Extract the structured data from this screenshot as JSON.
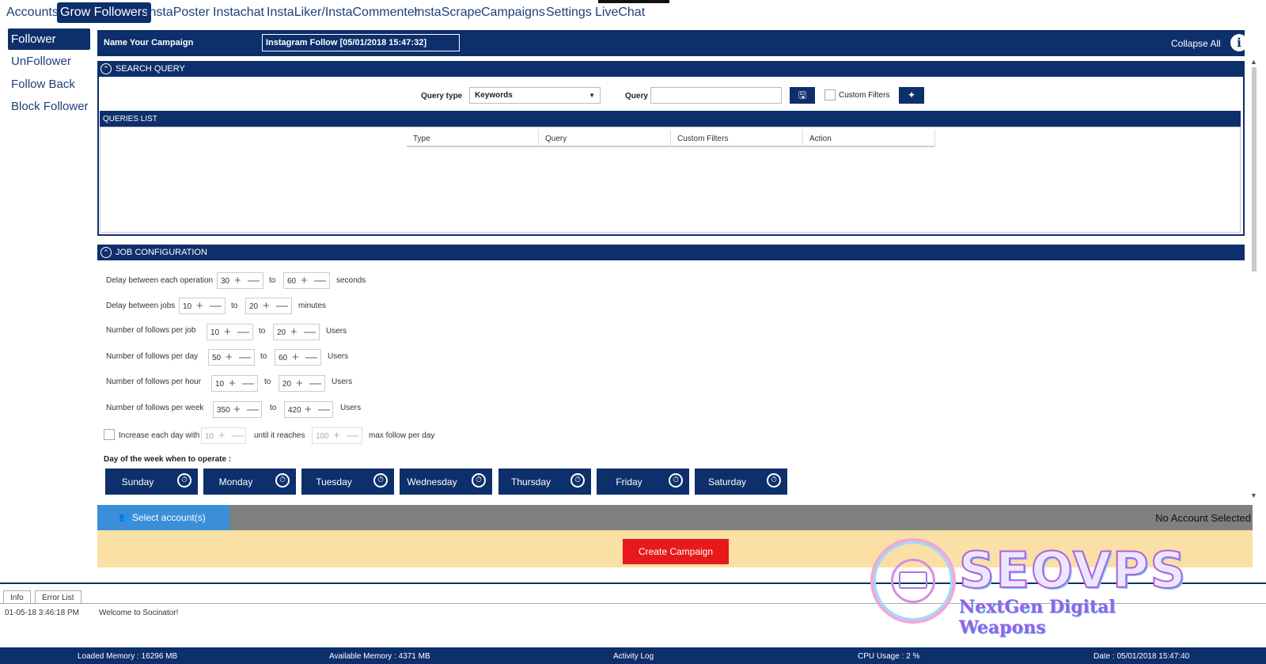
{
  "topnav": {
    "items": [
      "Accounts",
      "Grow Followers",
      "InstaPoster",
      "Instachat",
      "InstaLiker/InstaCommenter",
      "InstaScrape",
      "Campaigns",
      "Settings",
      "LiveChat"
    ],
    "active": "Grow Followers"
  },
  "sidenav": {
    "items": [
      "Follower",
      "UnFollower",
      "Follow Back",
      "Block Follower"
    ],
    "active": "Follower"
  },
  "campaign": {
    "name_label": "Name Your Campaign",
    "name_value": "Instagram Follow [05/01/2018 15:47:32]",
    "collapse_label": "Collapse All",
    "info_icon": "i"
  },
  "search_query": {
    "title": "SEARCH QUERY",
    "query_type_label": "Query type",
    "query_type_value": "Keywords",
    "query_label": "Query",
    "query_value": "",
    "custom_filters_label": "Custom Filters",
    "custom_filters_checked": false,
    "icons": [
      "save-query-icon",
      "add-filter-icon"
    ]
  },
  "queries_list": {
    "title": "QUERIES LIST",
    "columns": [
      "Type",
      "Query",
      "Custom Filters",
      "Action"
    ],
    "rows": []
  },
  "job_config": {
    "title": "JOB CONFIGURATION",
    "rows": [
      {
        "label": "Delay between each operation",
        "from": "30",
        "to_label": "to",
        "to": "60",
        "unit": "seconds"
      },
      {
        "label": "Delay between jobs",
        "from": "10",
        "to_label": "to",
        "to": "20",
        "unit": "minutes"
      },
      {
        "label": "Number of follows per job",
        "from": "10",
        "to_label": "to",
        "to": "20",
        "unit": "Users"
      },
      {
        "label": "Number of follows per day",
        "from": "50",
        "to_label": "to",
        "to": "60",
        "unit": "Users"
      },
      {
        "label": "Number of follows per hour",
        "from": "10",
        "to_label": "to",
        "to": "20",
        "unit": "Users"
      },
      {
        "label": "Number of follows per week",
        "from": "350",
        "to_label": "to",
        "to": "420",
        "unit": "Users"
      }
    ],
    "increase": {
      "label": "Increase each day with",
      "value": "10",
      "until_label": "until it reaches",
      "max": "100",
      "suffix": "max follow per day",
      "checked": false
    },
    "days_title": "Day of the week when to operate :",
    "days": [
      "Sunday",
      "Monday",
      "Tuesday",
      "Wednesday",
      "Thursday",
      "Friday",
      "Saturday"
    ]
  },
  "accounts": {
    "select_label": "Select account(s)",
    "status": "No Account Selected"
  },
  "create_button": "Create Campaign",
  "log": {
    "tabs": [
      "Info",
      "Error List"
    ],
    "entries": [
      {
        "time": "01-05-18 3:46:18 PM",
        "message": "Welcome to Socinator!"
      }
    ]
  },
  "status_bar": {
    "loaded_memory": "Loaded Memory : 16296 MB",
    "available_memory": "Available Memory : 4371  MB",
    "activity_log": "Activity Log",
    "cpu_usage": "CPU Usage : 2 %",
    "date": "Date : 05/01/2018 15:47:40"
  },
  "watermark": {
    "brand": "SEOVPS",
    "tagline": "NextGen Digital Weapons"
  },
  "colors": {
    "navy": "#0d2f6b",
    "accent_blue": "#3a8fd8",
    "create_red": "#e8191b",
    "create_area": "#fae0a5",
    "account_bar": "#808080"
  }
}
